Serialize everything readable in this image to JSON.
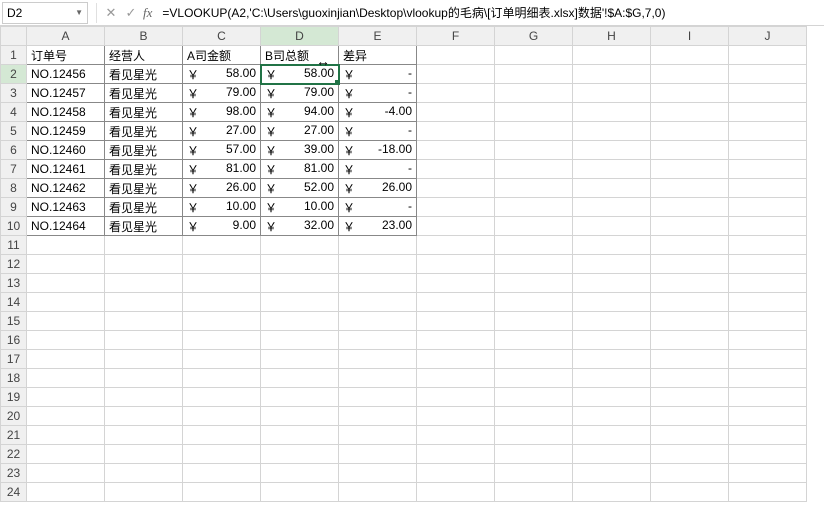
{
  "formula_bar": {
    "name_box": "D2",
    "cancel": "✕",
    "accept": "✓",
    "fx": "fx",
    "formula": "=VLOOKUP(A2,'C:\\Users\\guoxinjian\\Desktop\\vlookup的毛病\\[订单明细表.xlsx]数据'!$A:$G,7,0)"
  },
  "columns": [
    "A",
    "B",
    "C",
    "D",
    "E",
    "F",
    "G",
    "H",
    "I",
    "J"
  ],
  "active_col": "D",
  "active_row": 2,
  "headers": {
    "A": "订单号",
    "B": "经营人",
    "C": "A司金额",
    "D": "B司总额",
    "E": "差异"
  },
  "currency_symbol": "￥",
  "rows": [
    {
      "r": 2,
      "order": "NO.12456",
      "mgr": "看见星光",
      "a": "58.00",
      "b": "58.00",
      "diff": "-"
    },
    {
      "r": 3,
      "order": "NO.12457",
      "mgr": "看见星光",
      "a": "79.00",
      "b": "79.00",
      "diff": "-"
    },
    {
      "r": 4,
      "order": "NO.12458",
      "mgr": "看见星光",
      "a": "98.00",
      "b": "94.00",
      "diff": "-4.00"
    },
    {
      "r": 5,
      "order": "NO.12459",
      "mgr": "看见星光",
      "a": "27.00",
      "b": "27.00",
      "diff": "-"
    },
    {
      "r": 6,
      "order": "NO.12460",
      "mgr": "看见星光",
      "a": "57.00",
      "b": "39.00",
      "diff": "-18.00"
    },
    {
      "r": 7,
      "order": "NO.12461",
      "mgr": "看见星光",
      "a": "81.00",
      "b": "81.00",
      "diff": "-"
    },
    {
      "r": 8,
      "order": "NO.12462",
      "mgr": "看见星光",
      "a": "26.00",
      "b": "52.00",
      "diff": "26.00"
    },
    {
      "r": 9,
      "order": "NO.12463",
      "mgr": "看见星光",
      "a": "10.00",
      "b": "10.00",
      "diff": "-"
    },
    {
      "r": 10,
      "order": "NO.12464",
      "mgr": "看见星光",
      "a": "9.00",
      "b": "32.00",
      "diff": "23.00"
    }
  ],
  "empty_rows": [
    11,
    12,
    13,
    14,
    15,
    16,
    17,
    18,
    19,
    20,
    21,
    22,
    23,
    24
  ],
  "cursor_glyph": "↔"
}
